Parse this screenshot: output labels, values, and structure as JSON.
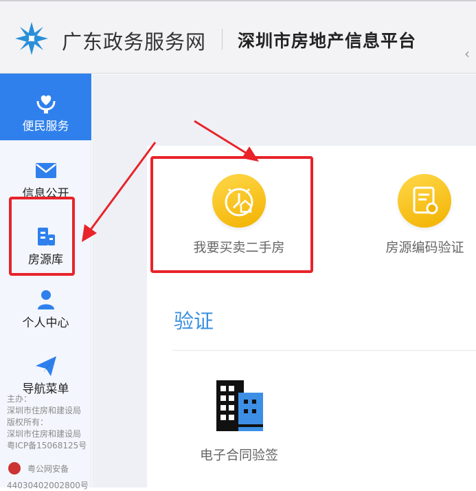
{
  "header": {
    "brand": "广东政务服务网",
    "platform": "深圳市房地产信息平台",
    "collapse_icon": "chevron-left-icon"
  },
  "sidebar": {
    "items": [
      {
        "label": "便民服务",
        "icon": "heart-hands-icon",
        "active": true
      },
      {
        "label": "信息公开",
        "icon": "mail-icon"
      },
      {
        "label": "房源库",
        "icon": "building-list-icon"
      },
      {
        "label": "个人中心",
        "icon": "user-icon"
      },
      {
        "label": "导航菜单",
        "icon": "paper-plane-icon"
      }
    ],
    "footer": {
      "host_label": "主办：",
      "host": "深圳市住房和建设局",
      "copyright_label": "版权所有：",
      "copyright": "深圳市住房和建设局",
      "icp": "粤ICP备15068125号",
      "police": "粤公网安备",
      "police_no": "44030402002800号"
    }
  },
  "main": {
    "services": [
      {
        "label": "我要买卖二手房",
        "icon": "alarm-house-icon"
      },
      {
        "label": "房源编码验证",
        "icon": "certificate-icon"
      }
    ],
    "section_title": "验证",
    "verify_items": [
      {
        "label": "电子合同验签",
        "icon": "office-building-icon"
      }
    ]
  },
  "colors": {
    "accent": "#2f80ed",
    "annotation": "#e8232a",
    "icon_gold": "#f2b200",
    "section_title": "#3a8fe0"
  }
}
